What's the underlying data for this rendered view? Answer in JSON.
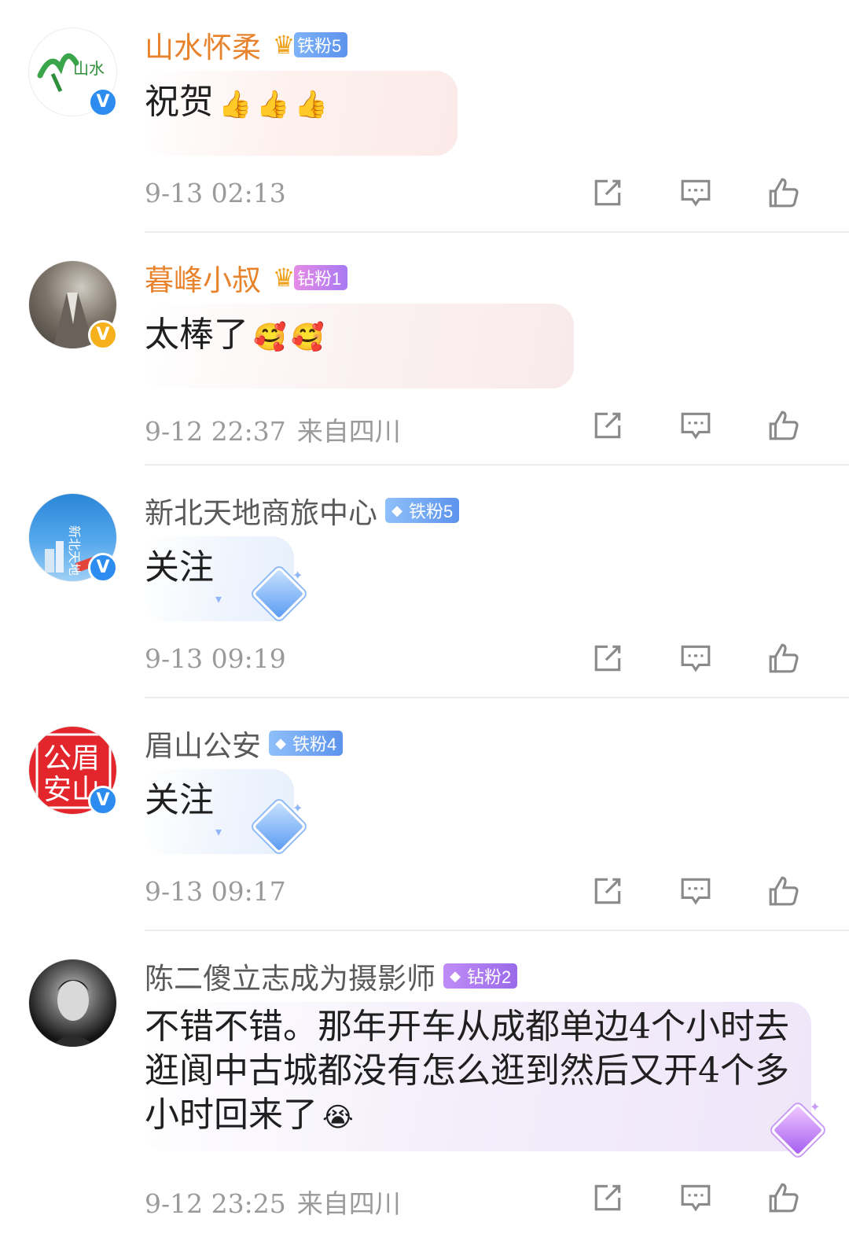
{
  "comments": [
    {
      "user": "山水怀柔",
      "fan_badge": "铁粉5",
      "text": "祝贺",
      "emojis": [
        "👍",
        "👍",
        "👍"
      ],
      "time": "9-13 02:13",
      "location": ""
    },
    {
      "user": "暮峰小叔",
      "fan_badge": "钻粉1",
      "text": "太棒了",
      "emojis": [
        "🥰",
        "🥰"
      ],
      "time": "9-12 22:37",
      "location": "来自四川"
    },
    {
      "user": "新北天地商旅中心",
      "fan_badge": "铁粉5",
      "text": "关注",
      "emojis": [],
      "time": "9-13 09:19",
      "location": ""
    },
    {
      "user": "眉山公安",
      "fan_badge": "铁粉4",
      "text": "关注",
      "emojis": [],
      "time": "9-13 09:17",
      "location": ""
    },
    {
      "user": "陈二傻立志成为摄影师",
      "fan_badge": "钻粉2",
      "text_line1": "不错不错。那年开车从成都单边4个小时去",
      "text_line2": "逛阆中古城都没有怎么逛到然后又开4个多",
      "text_line3": "小时回来了",
      "emojis": [
        "😭"
      ],
      "time": "9-12 23:25",
      "location": "来自四川"
    }
  ],
  "avatar_text": {
    "c1": "山水",
    "c3": "新北天地",
    "c4_line1": "公眉",
    "c4_line2": "安山"
  },
  "colors": {
    "vip_name": "#e8832d",
    "meta": "#9a9a9a",
    "verified_blue": "#2d8cf0",
    "verified_gold": "#f5b01c"
  },
  "icons": [
    "share-icon",
    "comment-icon",
    "like-icon"
  ]
}
